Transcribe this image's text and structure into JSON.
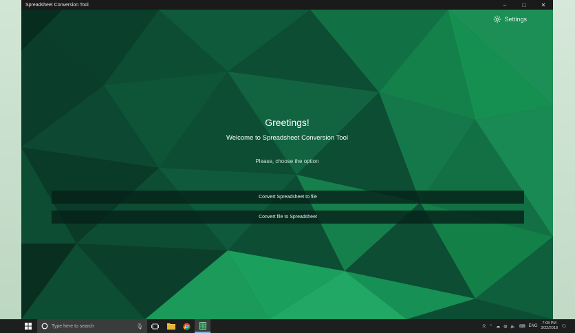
{
  "window": {
    "title": "Spreadsheet Conversion Tool",
    "controls": {
      "minimize": "–",
      "maximize": "□",
      "close": "✕"
    }
  },
  "header": {
    "settings_label": "Settings"
  },
  "main": {
    "greeting": "Greetings!",
    "welcome": "Welcome to Spreadsheet Conversion Tool",
    "prompt": "Please, choose the option",
    "buttons": [
      {
        "label": "Convert Spreadsheet to file"
      },
      {
        "label": "Convert file to Spreadsheet"
      }
    ]
  },
  "taskbar": {
    "search_placeholder": "Type here to search",
    "language": "ENG",
    "time": "7:08 PM",
    "date": "3/22/2018"
  },
  "colors": {
    "accent_green": "#0b4a31",
    "taskbar": "#1c1f1e",
    "button_bg": "#06221a"
  }
}
